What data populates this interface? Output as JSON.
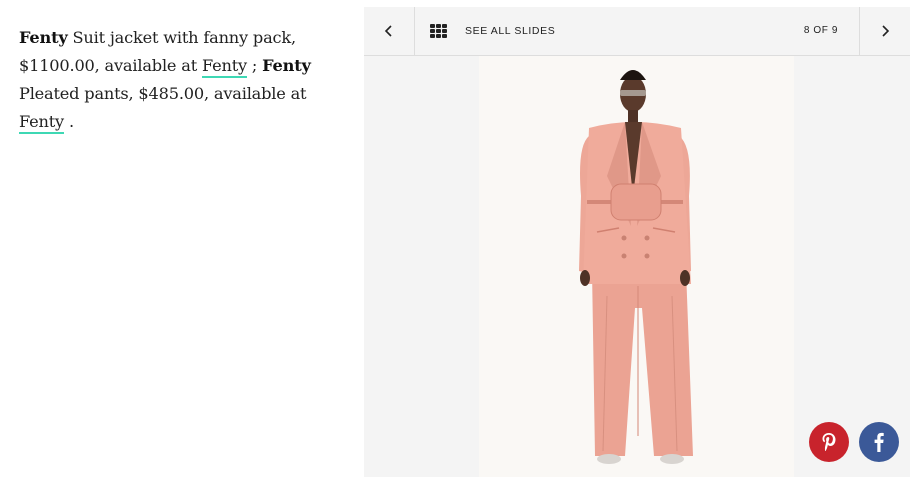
{
  "caption": {
    "item1_brand": "Fenty",
    "item1_desc": " Suit jacket with fanny pack, $1100.00, available at ",
    "item1_link": "Fenty",
    "separator": " ; ",
    "item2_brand": "Fenty",
    "item2_desc": " Pleated pants, $485.00, available at ",
    "item2_link": "Fenty",
    "end": " ."
  },
  "slideshow": {
    "see_all_label": "SEE ALL SLIDES",
    "counter": "8 OF 9",
    "current_slide": 8,
    "total_slides": 9,
    "prev_icon": "chevron-left-icon",
    "next_icon": "chevron-right-icon",
    "grid_icon": "grid-icon"
  },
  "share": {
    "pinterest_icon": "pinterest-icon",
    "pinterest_color": "#c8232c",
    "facebook_icon": "facebook-icon",
    "facebook_color": "#3b5998"
  },
  "colors": {
    "link_underline": "#3ed8b4",
    "panel_bg": "#f4f4f4",
    "suit": "#eda797"
  }
}
